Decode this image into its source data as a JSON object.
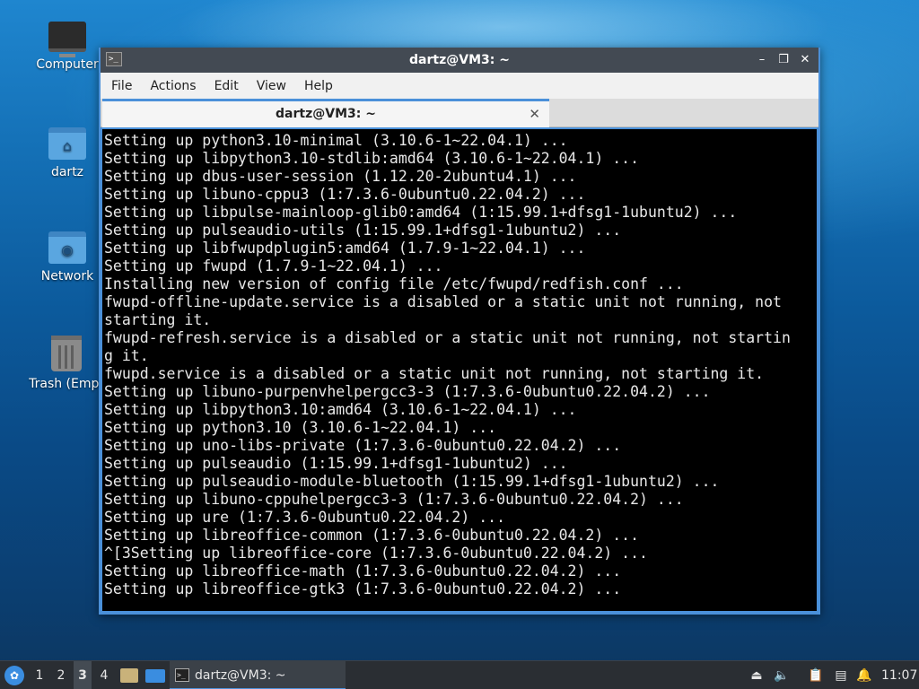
{
  "desktop": {
    "icons": [
      {
        "label": "Computer",
        "icon": "computer-icon"
      },
      {
        "label": "dartz",
        "icon": "home-folder-icon"
      },
      {
        "label": "Network",
        "icon": "network-folder-icon"
      },
      {
        "label": "Trash (Empt",
        "icon": "trash-icon"
      }
    ]
  },
  "window": {
    "title": "dartz@VM3: ~",
    "controls": {
      "minimize": "–",
      "restore": "❐",
      "close": "✕"
    },
    "menu": [
      "File",
      "Actions",
      "Edit",
      "View",
      "Help"
    ],
    "tab": {
      "label": "dartz@VM3: ~",
      "close": "✕"
    },
    "lines": [
      "Setting up python3.10-minimal (3.10.6-1~22.04.1) ...",
      "Setting up libpython3.10-stdlib:amd64 (3.10.6-1~22.04.1) ...",
      "Setting up dbus-user-session (1.12.20-2ubuntu4.1) ...",
      "Setting up libuno-cppu3 (1:7.3.6-0ubuntu0.22.04.2) ...",
      "Setting up libpulse-mainloop-glib0:amd64 (1:15.99.1+dfsg1-1ubuntu2) ...",
      "Setting up pulseaudio-utils (1:15.99.1+dfsg1-1ubuntu2) ...",
      "Setting up libfwupdplugin5:amd64 (1.7.9-1~22.04.1) ...",
      "Setting up fwupd (1.7.9-1~22.04.1) ...",
      "Installing new version of config file /etc/fwupd/redfish.conf ...",
      "fwupd-offline-update.service is a disabled or a static unit not running, not",
      "starting it.",
      "fwupd-refresh.service is a disabled or a static unit not running, not startin",
      "g it.",
      "fwupd.service is a disabled or a static unit not running, not starting it.",
      "Setting up libuno-purpenvhelpergcc3-3 (1:7.3.6-0ubuntu0.22.04.2) ...",
      "Setting up libpython3.10:amd64 (3.10.6-1~22.04.1) ...",
      "Setting up python3.10 (3.10.6-1~22.04.1) ...",
      "Setting up uno-libs-private (1:7.3.6-0ubuntu0.22.04.2) ...",
      "Setting up pulseaudio (1:15.99.1+dfsg1-1ubuntu2) ...",
      "Setting up pulseaudio-module-bluetooth (1:15.99.1+dfsg1-1ubuntu2) ...",
      "Setting up libuno-cppuhelpergcc3-3 (1:7.3.6-0ubuntu0.22.04.2) ...",
      "Setting up ure (1:7.3.6-0ubuntu0.22.04.2) ...",
      "Setting up libreoffice-common (1:7.3.6-0ubuntu0.22.04.2) ...",
      "^[3Setting up libreoffice-core (1:7.3.6-0ubuntu0.22.04.2) ...",
      "Setting up libreoffice-math (1:7.3.6-0ubuntu0.22.04.2) ...",
      "Setting up libreoffice-gtk3 (1:7.3.6-0ubuntu0.22.04.2) ..."
    ]
  },
  "taskbar": {
    "workspaces": [
      "1",
      "2",
      "3",
      "4"
    ],
    "active_workspace": "3",
    "task_label": "dartz@VM3: ~",
    "clock": "11:07"
  },
  "colors": {
    "accent": "#4a90d9",
    "terminal_bg": "#000000",
    "terminal_fg": "#e8e8e8"
  }
}
